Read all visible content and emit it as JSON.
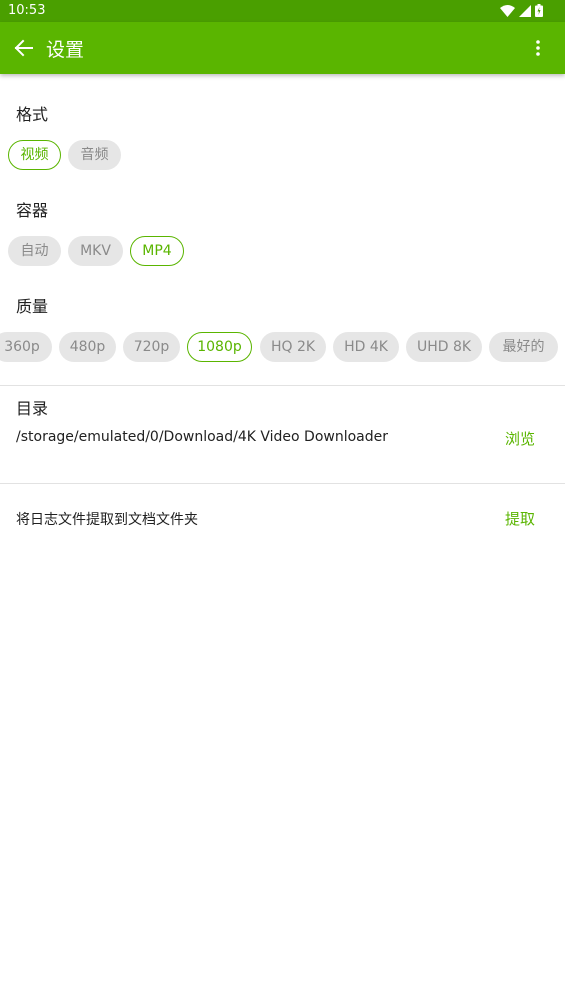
{
  "status_bar": {
    "time": "10:53"
  },
  "app_bar": {
    "title": "设置"
  },
  "format": {
    "title": "格式",
    "options": [
      {
        "label": "视频",
        "selected": true
      },
      {
        "label": "音频",
        "selected": false
      }
    ]
  },
  "container": {
    "title": "容器",
    "options": [
      {
        "label": "自动",
        "selected": false
      },
      {
        "label": "MKV",
        "selected": false
      },
      {
        "label": "MP4",
        "selected": true
      }
    ]
  },
  "quality": {
    "title": "质量",
    "options": [
      {
        "label": "360p",
        "selected": false
      },
      {
        "label": "480p",
        "selected": false
      },
      {
        "label": "720p",
        "selected": false
      },
      {
        "label": "1080p",
        "selected": true
      },
      {
        "label": "HQ 2K",
        "selected": false
      },
      {
        "label": "HD 4K",
        "selected": false
      },
      {
        "label": "UHD 8K",
        "selected": false
      },
      {
        "label": "最好的",
        "selected": false
      }
    ]
  },
  "directory": {
    "title": "目录",
    "path": "/storage/emulated/0/Download/4K Video Downloader",
    "browse_label": "浏览"
  },
  "logs": {
    "text": "将日志文件提取到文档文件夹",
    "extract_label": "提取"
  },
  "colors": {
    "accent": "#5ab500",
    "status_bar": "#4a9f00",
    "chip_bg": "#e6e6e6"
  }
}
